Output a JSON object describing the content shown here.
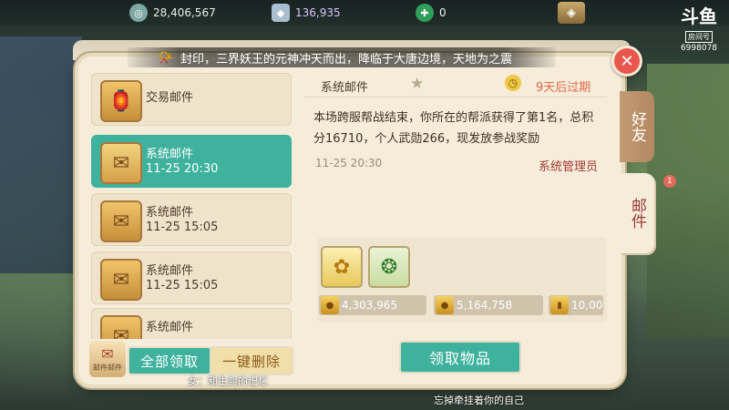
{
  "currencies": [
    {
      "icon": "silver-coin-icon",
      "value": "28,406,567"
    },
    {
      "icon": "ingot-icon",
      "value": "136,935"
    },
    {
      "icon": "jade-coin-icon",
      "value": "0"
    }
  ],
  "watermark": {
    "logo": "斗鱼",
    "tag": "房间号",
    "room": "6998078"
  },
  "notice": "封印，三界妖王的元神冲天而出，降临于大唐边境，天地为之震",
  "side_tabs": {
    "friends": "好友",
    "mail": "邮件",
    "mail_badge": "1"
  },
  "mail_list": [
    {
      "title": "交易邮件",
      "time": "",
      "type": "trade",
      "icon": "trade-mail-icon",
      "selected": false
    },
    {
      "title": "系统邮件",
      "time": "11-25 20:30",
      "type": "system",
      "icon": "opened-mail-icon",
      "selected": true
    },
    {
      "title": "系统邮件",
      "time": "11-25 15:05",
      "type": "system",
      "icon": "envelope-icon",
      "selected": false
    },
    {
      "title": "系统邮件",
      "time": "11-25 15:05",
      "type": "system",
      "icon": "envelope-icon",
      "selected": false
    },
    {
      "title": "系统邮件",
      "time": "",
      "type": "system",
      "icon": "envelope-icon",
      "selected": false
    }
  ],
  "detail": {
    "title": "系统邮件",
    "expire": "9天后过期",
    "body": "本场跨服帮战结束，你所在的帮派获得了第1名，总积分16710，个人武勋266，现发放参战奖励",
    "time": "11-25 20:30",
    "sender": "系统管理员",
    "items": [
      {
        "icon": "golden-flower-icon"
      },
      {
        "icon": "jade-ring-icon"
      }
    ],
    "rewards": [
      {
        "icon": "coin-pile-icon",
        "value": "4,303,965"
      },
      {
        "icon": "coin-pile-icon",
        "value": "5,164,758"
      },
      {
        "icon": "gold-bar-icon",
        "value": "10,00"
      }
    ]
  },
  "buttons": {
    "mini_label": "邮件邮件",
    "claim_all": "全部领取",
    "delete_all": "一键删除",
    "receive": "领取物品"
  },
  "subtitles": [
    "女：和生封的记忆",
    "忘掉牵挂着你的自己"
  ]
}
